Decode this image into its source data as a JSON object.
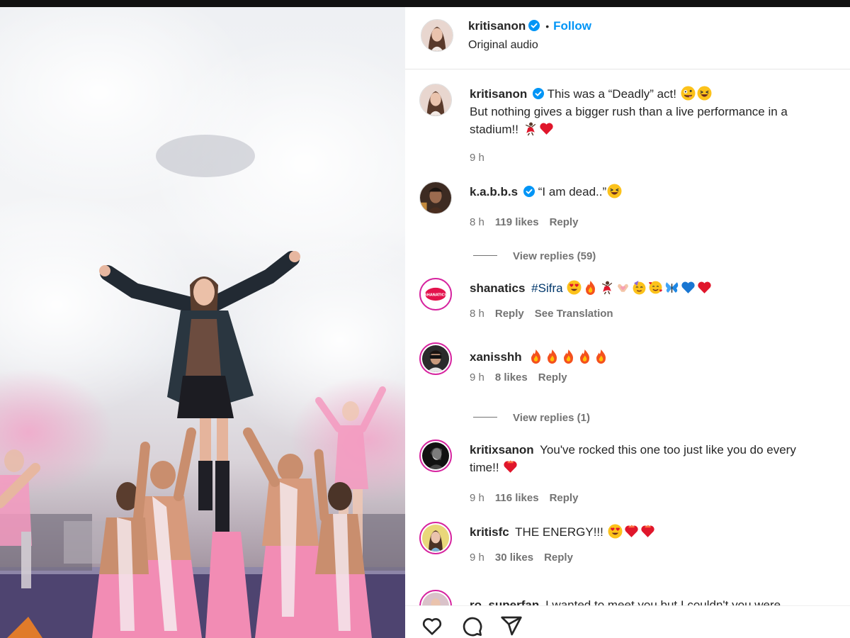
{
  "post": {
    "username": "kritisanon",
    "follow_label": "Follow",
    "audio_label": "Original audio",
    "separator": "•"
  },
  "comments": [
    {
      "username": "kritisanon",
      "verified": true,
      "text_line1": "This was a “Deadly” act!",
      "text_line2": "But nothing gives a bigger rush than a live performance in a",
      "text_line3": "stadium!!",
      "time": "9 h"
    },
    {
      "username": "k.a.b.b.s",
      "verified": true,
      "text": "“I am dead..”",
      "time": "8 h",
      "likes": "119 likes",
      "reply": "Reply",
      "view_replies": "View replies (59)"
    },
    {
      "username": "shanatics",
      "hashtag": "#Sifra",
      "time": "8 h",
      "reply": "Reply",
      "translation": "See Translation",
      "avatar_text": "SHANATICS"
    },
    {
      "username": "xanisshh",
      "time": "9 h",
      "likes": "8 likes",
      "reply": "Reply",
      "view_replies": "View replies (1)"
    },
    {
      "username": "kritixsanon",
      "text_line1": "You've rocked this one too just like you do every",
      "text_line2": "time!!",
      "time": "9 h",
      "likes": "116 likes",
      "reply": "Reply"
    },
    {
      "username": "kritisfc",
      "text": "THE ENERGY!!!",
      "time": "9 h",
      "likes": "30 likes",
      "reply": "Reply"
    },
    {
      "username": "ro_superfan",
      "text": "I wanted to meet you but I couldn't you were"
    }
  ],
  "actions": [
    "heart-icon",
    "comment-icon",
    "share-icon"
  ],
  "colors": {
    "accent_blue": "#0095f6",
    "hashtag": "#00376b",
    "meta_gray": "#737373",
    "story_ring": "#d6249f",
    "heart_red": "#e0162b"
  }
}
